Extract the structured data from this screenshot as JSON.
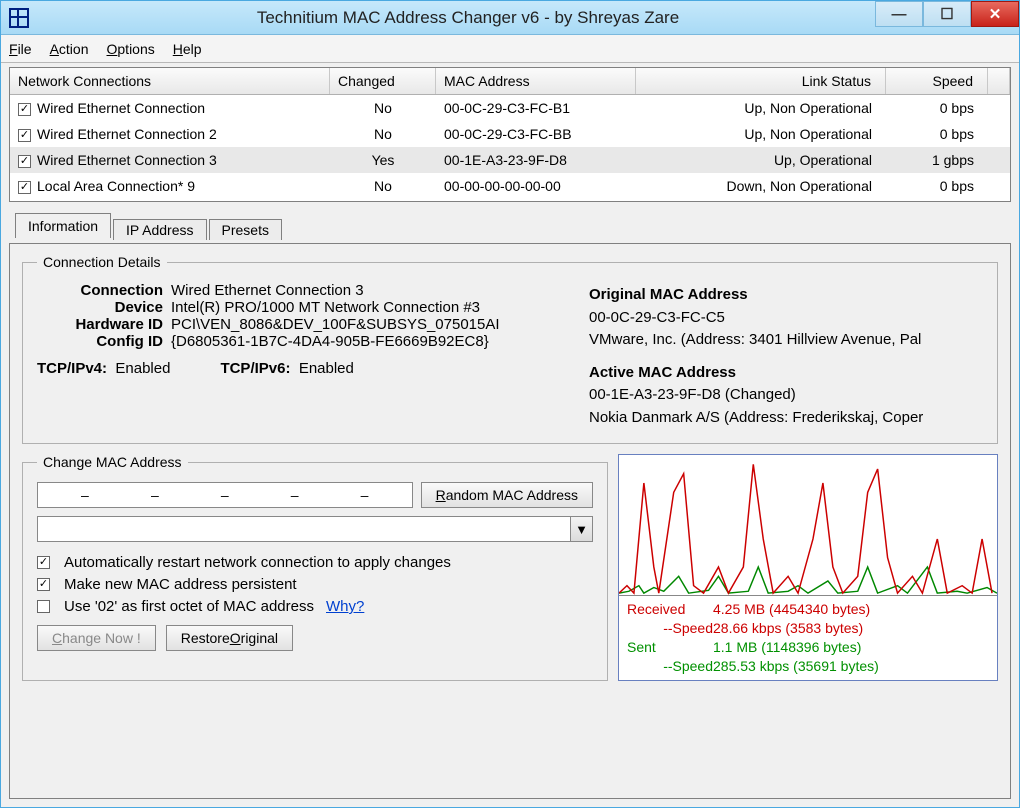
{
  "window": {
    "title": "Technitium MAC Address Changer v6 - by Shreyas Zare"
  },
  "menu": {
    "file": "File",
    "action": "Action",
    "options": "Options",
    "help": "Help"
  },
  "table": {
    "headers": {
      "name": "Network Connections",
      "changed": "Changed",
      "mac": "MAC Address",
      "link": "Link Status",
      "speed": "Speed"
    },
    "rows": [
      {
        "checked": true,
        "name": "Wired Ethernet Connection",
        "changed": "No",
        "mac": "00-0C-29-C3-FC-B1",
        "link": "Up, Non Operational",
        "speed": "0 bps"
      },
      {
        "checked": true,
        "name": "Wired Ethernet Connection 2",
        "changed": "No",
        "mac": "00-0C-29-C3-FC-BB",
        "link": "Up, Non Operational",
        "speed": "0 bps"
      },
      {
        "checked": true,
        "name": "Wired Ethernet Connection 3",
        "changed": "Yes",
        "mac": "00-1E-A3-23-9F-D8",
        "link": "Up, Operational",
        "speed": "1 gbps",
        "selected": true
      },
      {
        "checked": true,
        "name": "Local Area Connection* 9",
        "changed": "No",
        "mac": "00-00-00-00-00-00",
        "link": "Down, Non Operational",
        "speed": "0 bps"
      }
    ]
  },
  "tabs": {
    "info": "Information",
    "ip": "IP Address",
    "presets": "Presets"
  },
  "details": {
    "legend": "Connection Details",
    "connection_k": "Connection",
    "connection_v": "Wired Ethernet Connection 3",
    "device_k": "Device",
    "device_v": "Intel(R) PRO/1000 MT Network Connection #3",
    "hwid_k": "Hardware ID",
    "hwid_v": "PCI\\VEN_8086&DEV_100F&SUBSYS_075015AI",
    "cfgid_k": "Config ID",
    "cfgid_v": "{D6805361-1B7C-4DA4-905B-FE6669B92EC8}",
    "tcp4_k": "TCP/IPv4:",
    "tcp4_v": "Enabled",
    "tcp6_k": "TCP/IPv6:",
    "tcp6_v": "Enabled",
    "orig_header": "Original MAC Address",
    "orig_mac": "00-0C-29-C3-FC-C5",
    "orig_vendor": "VMware, Inc.  (Address: 3401 Hillview Avenue, Pal",
    "active_header": "Active MAC Address",
    "active_mac": "00-1E-A3-23-9F-D8 (Changed)",
    "active_vendor": "Nokia Danmark A/S  (Address: Frederikskaj, Coper"
  },
  "change": {
    "legend": "Change MAC Address",
    "random_btn": "Random MAC Address",
    "auto_restart": "Automatically restart network connection to apply changes",
    "persistent": "Make new MAC address persistent",
    "use02": "Use '02' as first octet of MAC address",
    "why": "Why?",
    "change_btn": "Change Now !",
    "restore_btn": "Restore Original",
    "auto_restart_checked": true,
    "persistent_checked": true,
    "use02_checked": false
  },
  "graph": {
    "received_label": "Received",
    "received_value": "4.25 MB (4454340 bytes)",
    "rspeed_label": "--Speed",
    "rspeed_value": "28.66 kbps (3583 bytes)",
    "sent_label": "Sent",
    "sent_value": "1.1 MB (1148396 bytes)",
    "sspeed_label": "--Speed",
    "sspeed_value": "285.53 kbps (35691 bytes)"
  }
}
